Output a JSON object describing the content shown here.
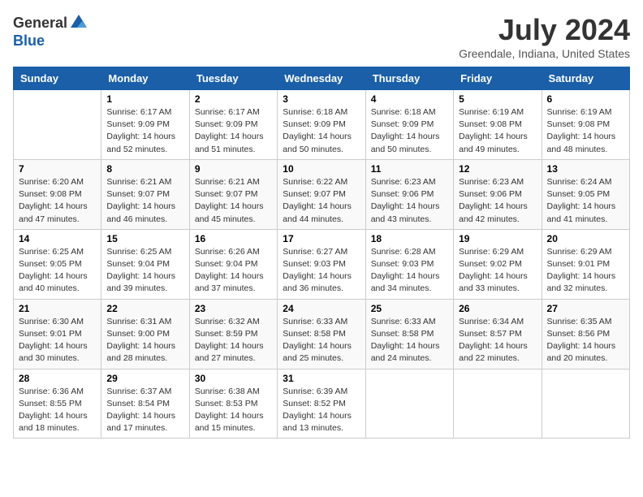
{
  "logo": {
    "general": "General",
    "blue": "Blue"
  },
  "title": "July 2024",
  "subtitle": "Greendale, Indiana, United States",
  "days_header": [
    "Sunday",
    "Monday",
    "Tuesday",
    "Wednesday",
    "Thursday",
    "Friday",
    "Saturday"
  ],
  "weeks": [
    [
      {
        "num": "",
        "detail": ""
      },
      {
        "num": "1",
        "detail": "Sunrise: 6:17 AM\nSunset: 9:09 PM\nDaylight: 14 hours\nand 52 minutes."
      },
      {
        "num": "2",
        "detail": "Sunrise: 6:17 AM\nSunset: 9:09 PM\nDaylight: 14 hours\nand 51 minutes."
      },
      {
        "num": "3",
        "detail": "Sunrise: 6:18 AM\nSunset: 9:09 PM\nDaylight: 14 hours\nand 50 minutes."
      },
      {
        "num": "4",
        "detail": "Sunrise: 6:18 AM\nSunset: 9:09 PM\nDaylight: 14 hours\nand 50 minutes."
      },
      {
        "num": "5",
        "detail": "Sunrise: 6:19 AM\nSunset: 9:08 PM\nDaylight: 14 hours\nand 49 minutes."
      },
      {
        "num": "6",
        "detail": "Sunrise: 6:19 AM\nSunset: 9:08 PM\nDaylight: 14 hours\nand 48 minutes."
      }
    ],
    [
      {
        "num": "7",
        "detail": "Sunrise: 6:20 AM\nSunset: 9:08 PM\nDaylight: 14 hours\nand 47 minutes."
      },
      {
        "num": "8",
        "detail": "Sunrise: 6:21 AM\nSunset: 9:07 PM\nDaylight: 14 hours\nand 46 minutes."
      },
      {
        "num": "9",
        "detail": "Sunrise: 6:21 AM\nSunset: 9:07 PM\nDaylight: 14 hours\nand 45 minutes."
      },
      {
        "num": "10",
        "detail": "Sunrise: 6:22 AM\nSunset: 9:07 PM\nDaylight: 14 hours\nand 44 minutes."
      },
      {
        "num": "11",
        "detail": "Sunrise: 6:23 AM\nSunset: 9:06 PM\nDaylight: 14 hours\nand 43 minutes."
      },
      {
        "num": "12",
        "detail": "Sunrise: 6:23 AM\nSunset: 9:06 PM\nDaylight: 14 hours\nand 42 minutes."
      },
      {
        "num": "13",
        "detail": "Sunrise: 6:24 AM\nSunset: 9:05 PM\nDaylight: 14 hours\nand 41 minutes."
      }
    ],
    [
      {
        "num": "14",
        "detail": "Sunrise: 6:25 AM\nSunset: 9:05 PM\nDaylight: 14 hours\nand 40 minutes."
      },
      {
        "num": "15",
        "detail": "Sunrise: 6:25 AM\nSunset: 9:04 PM\nDaylight: 14 hours\nand 39 minutes."
      },
      {
        "num": "16",
        "detail": "Sunrise: 6:26 AM\nSunset: 9:04 PM\nDaylight: 14 hours\nand 37 minutes."
      },
      {
        "num": "17",
        "detail": "Sunrise: 6:27 AM\nSunset: 9:03 PM\nDaylight: 14 hours\nand 36 minutes."
      },
      {
        "num": "18",
        "detail": "Sunrise: 6:28 AM\nSunset: 9:03 PM\nDaylight: 14 hours\nand 34 minutes."
      },
      {
        "num": "19",
        "detail": "Sunrise: 6:29 AM\nSunset: 9:02 PM\nDaylight: 14 hours\nand 33 minutes."
      },
      {
        "num": "20",
        "detail": "Sunrise: 6:29 AM\nSunset: 9:01 PM\nDaylight: 14 hours\nand 32 minutes."
      }
    ],
    [
      {
        "num": "21",
        "detail": "Sunrise: 6:30 AM\nSunset: 9:01 PM\nDaylight: 14 hours\nand 30 minutes."
      },
      {
        "num": "22",
        "detail": "Sunrise: 6:31 AM\nSunset: 9:00 PM\nDaylight: 14 hours\nand 28 minutes."
      },
      {
        "num": "23",
        "detail": "Sunrise: 6:32 AM\nSunset: 8:59 PM\nDaylight: 14 hours\nand 27 minutes."
      },
      {
        "num": "24",
        "detail": "Sunrise: 6:33 AM\nSunset: 8:58 PM\nDaylight: 14 hours\nand 25 minutes."
      },
      {
        "num": "25",
        "detail": "Sunrise: 6:33 AM\nSunset: 8:58 PM\nDaylight: 14 hours\nand 24 minutes."
      },
      {
        "num": "26",
        "detail": "Sunrise: 6:34 AM\nSunset: 8:57 PM\nDaylight: 14 hours\nand 22 minutes."
      },
      {
        "num": "27",
        "detail": "Sunrise: 6:35 AM\nSunset: 8:56 PM\nDaylight: 14 hours\nand 20 minutes."
      }
    ],
    [
      {
        "num": "28",
        "detail": "Sunrise: 6:36 AM\nSunset: 8:55 PM\nDaylight: 14 hours\nand 18 minutes."
      },
      {
        "num": "29",
        "detail": "Sunrise: 6:37 AM\nSunset: 8:54 PM\nDaylight: 14 hours\nand 17 minutes."
      },
      {
        "num": "30",
        "detail": "Sunrise: 6:38 AM\nSunset: 8:53 PM\nDaylight: 14 hours\nand 15 minutes."
      },
      {
        "num": "31",
        "detail": "Sunrise: 6:39 AM\nSunset: 8:52 PM\nDaylight: 14 hours\nand 13 minutes."
      },
      {
        "num": "",
        "detail": ""
      },
      {
        "num": "",
        "detail": ""
      },
      {
        "num": "",
        "detail": ""
      }
    ]
  ]
}
